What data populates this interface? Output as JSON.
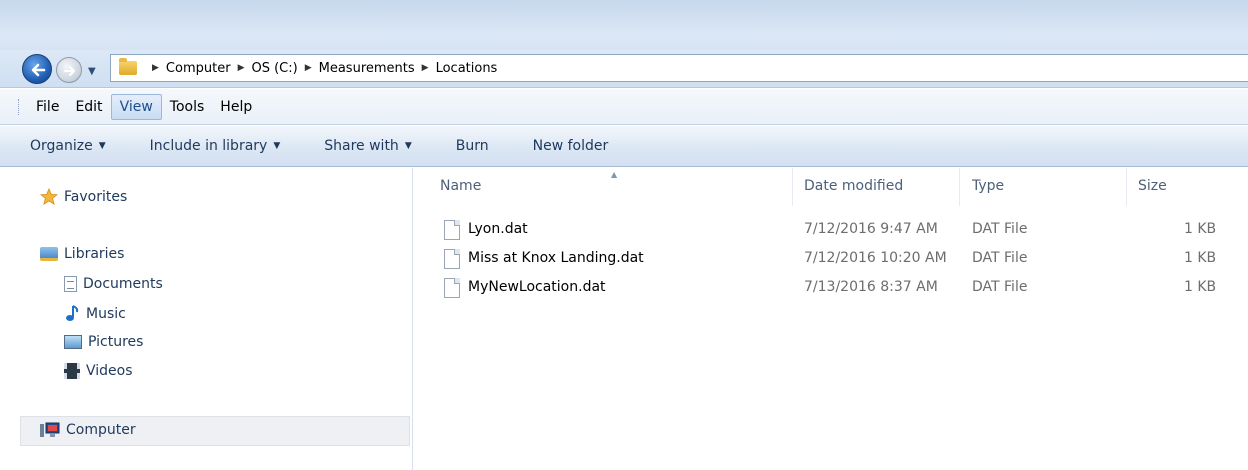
{
  "navigation": {
    "back_icon": "back-arrow-icon",
    "forward_icon": "forward-arrow-icon",
    "recent_dropdown_icon": "chevron-down-icon"
  },
  "address_bar": {
    "breadcrumbs": [
      "Computer",
      "OS (C:)",
      "Measurements",
      "Locations"
    ]
  },
  "menu": {
    "items": [
      "File",
      "Edit",
      "View",
      "Tools",
      "Help"
    ],
    "active": "View"
  },
  "toolbar": {
    "organize": "Organize",
    "include_in_library": "Include in library",
    "share_with": "Share with",
    "burn": "Burn",
    "new_folder": "New folder"
  },
  "nav_pane": {
    "favorites": "Favorites",
    "libraries": "Libraries",
    "documents": "Documents",
    "music": "Music",
    "pictures": "Pictures",
    "videos": "Videos",
    "computer": "Computer"
  },
  "columns": {
    "name": "Name",
    "date_modified": "Date modified",
    "type": "Type",
    "size": "Size"
  },
  "files": [
    {
      "name": "Lyon.dat",
      "date": "7/12/2016 9:47 AM",
      "type": "DAT File",
      "size": "1 KB"
    },
    {
      "name": "Miss at Knox Landing.dat",
      "date": "7/12/2016 10:20 AM",
      "type": "DAT File",
      "size": "1 KB"
    },
    {
      "name": "MyNewLocation.dat",
      "date": "7/13/2016 8:37 AM",
      "type": "DAT File",
      "size": "1 KB"
    }
  ],
  "colors": {
    "accent": "#1e395b",
    "toolbar": "#dbe6f4",
    "selection": "#eef0f3"
  }
}
